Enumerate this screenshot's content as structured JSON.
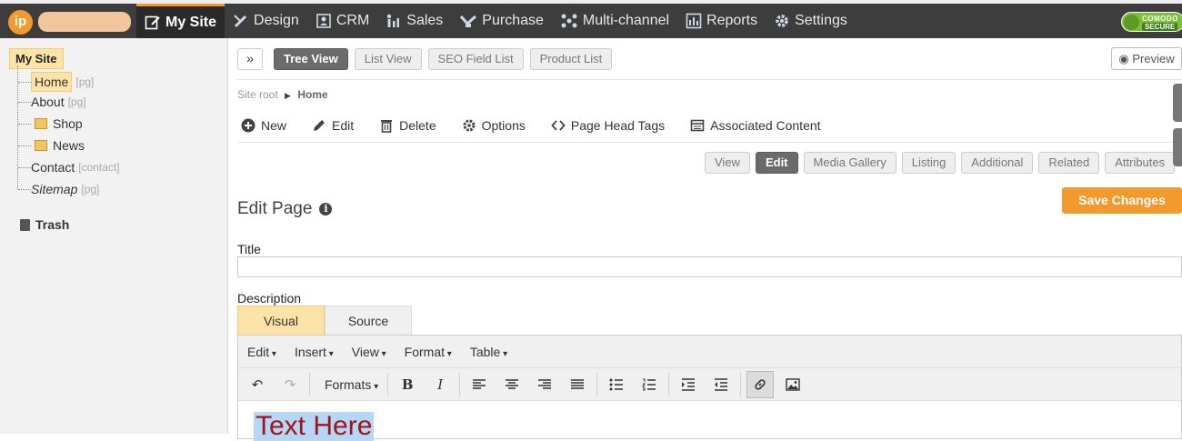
{
  "topbar": {
    "logo_text": "ip",
    "nav": [
      {
        "label": "My Site",
        "icon": "edit-page-icon"
      },
      {
        "label": "Design",
        "icon": "brush-icon"
      },
      {
        "label": "CRM",
        "icon": "contacts-icon"
      },
      {
        "label": "Sales",
        "icon": "sales-icon"
      },
      {
        "label": "Purchase",
        "icon": "handshake-icon"
      },
      {
        "label": "Multi-channel",
        "icon": "network-icon"
      },
      {
        "label": "Reports",
        "icon": "chart-icon"
      },
      {
        "label": "Settings",
        "icon": "gear-icon"
      }
    ],
    "badge_top": "COMODO",
    "badge_bottom": "SECURE",
    "colors": {
      "bar": "#3d3d3d",
      "accent": "#f39a2e",
      "badge": "#7cbf3a"
    }
  },
  "sidebar": {
    "root": "My Site",
    "items": [
      {
        "label": "Home",
        "type": "[pg]"
      },
      {
        "label": "About",
        "type": "[pg]"
      },
      {
        "label": "Shop",
        "type": ""
      },
      {
        "label": "News",
        "type": ""
      },
      {
        "label": "Contact",
        "type": "[contact]"
      },
      {
        "label": "Sitemap",
        "type": "[pg]"
      }
    ],
    "trash": "Trash"
  },
  "main": {
    "view_tabs": [
      "Tree View",
      "List View",
      "SEO Field List",
      "Product List"
    ],
    "preview": "Preview",
    "breadcrumb": {
      "root": "Site root",
      "current": "Home"
    },
    "actions": [
      "New",
      "Edit",
      "Delete",
      "Options",
      "Page Head Tags",
      "Associated Content"
    ],
    "sub_tabs": [
      "View",
      "Edit",
      "Media Gallery",
      "Listing",
      "Additional",
      "Related",
      "Attributes"
    ],
    "heading": "Edit Page",
    "info": "i",
    "save": "Save Changes",
    "title_label": "Title",
    "title_value": "",
    "description_label": "Description",
    "editor_tabs": [
      "Visual",
      "Source"
    ],
    "editor_menus": [
      "Edit",
      "Insert",
      "View",
      "Format",
      "Table"
    ],
    "formats_label": "Formats",
    "content_text": "Text Here"
  }
}
